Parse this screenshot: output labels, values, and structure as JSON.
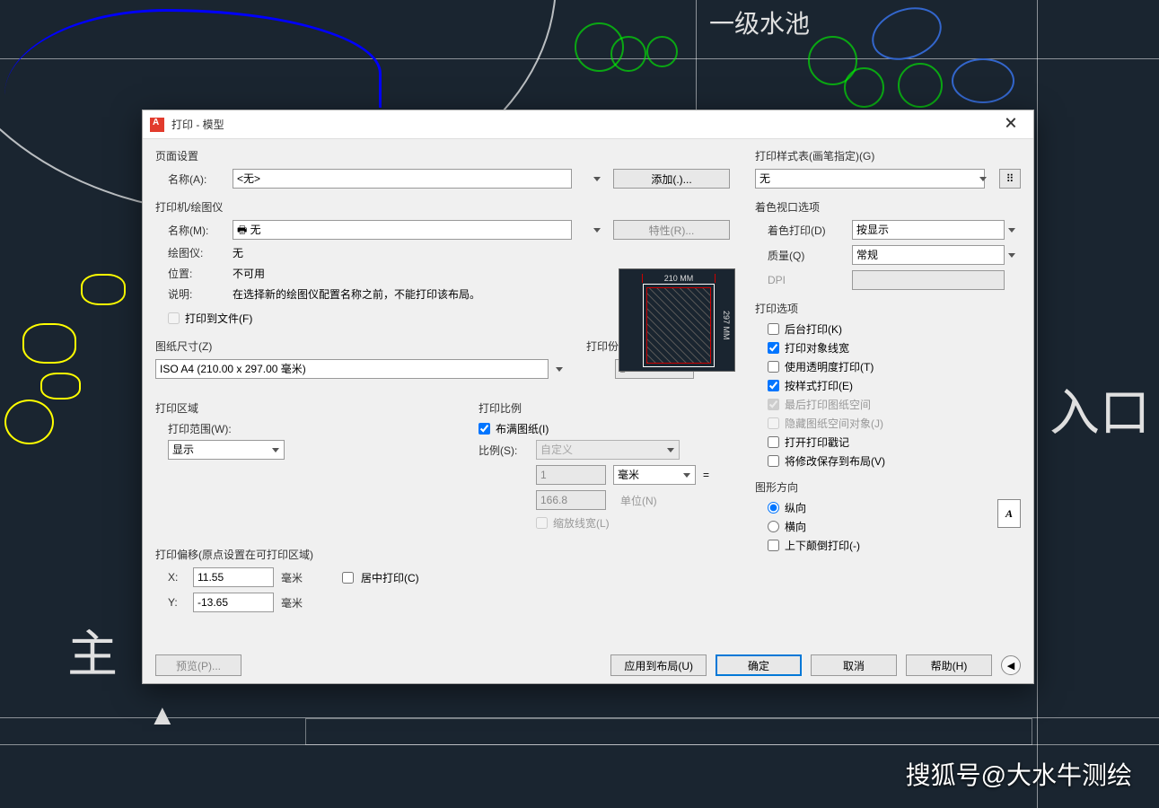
{
  "bg": {
    "pool": "一级水池",
    "entry": "入口",
    "main": "主",
    "watermark": "搜狐号@大水牛测绘"
  },
  "title": "打印 - 模型",
  "pageSetup": {
    "heading": "页面设置",
    "nameLabel": "名称(A):",
    "nameValue": "<无>",
    "addBtn": "添加(.)..."
  },
  "printer": {
    "heading": "打印机/绘图仪",
    "nameLabel": "名称(M):",
    "nameValue": "无",
    "propertiesBtn": "特性(R)...",
    "plotterLabel": "绘图仪:",
    "plotterValue": "无",
    "locationLabel": "位置:",
    "locationValue": "不可用",
    "descLabel": "说明:",
    "descValue": "在选择新的绘图仪配置名称之前，不能打印该布局。",
    "toFile": "打印到文件(F)",
    "pw": "210 MM",
    "ph": "297 MM"
  },
  "paperSize": {
    "heading": "图纸尺寸(Z)",
    "value": "ISO A4 (210.00 x 297.00 毫米)"
  },
  "copies": {
    "heading": "打印份数(B)",
    "value": "1"
  },
  "plotArea": {
    "heading": "打印区域",
    "rangeLabel": "打印范围(W):",
    "rangeValue": "显示"
  },
  "plotScale": {
    "heading": "打印比例",
    "fit": "布满图纸(I)",
    "scaleLabel": "比例(S):",
    "scaleValue": "自定义",
    "unitInput": "1",
    "unitSel": "毫米",
    "eq": "=",
    "drawInput": "166.8",
    "drawUnitLabel": "单位(N)",
    "lineweights": "缩放线宽(L)"
  },
  "plotOffset": {
    "heading": "打印偏移(原点设置在可打印区域)",
    "xLabel": "X:",
    "xValue": "11.55",
    "xUnit": "毫米",
    "yLabel": "Y:",
    "yValue": "-13.65",
    "yUnit": "毫米",
    "center": "居中打印(C)"
  },
  "styleTable": {
    "heading": "打印样式表(画笔指定)(G)",
    "value": "无"
  },
  "shaded": {
    "heading": "着色视口选项",
    "shadeLabel": "着色打印(D)",
    "shadeValue": "按显示",
    "qualityLabel": "质量(Q)",
    "qualityValue": "常规",
    "dpiLabel": "DPI"
  },
  "options": {
    "heading": "打印选项",
    "bg": "后台打印(K)",
    "lw": "打印对象线宽",
    "trans": "使用透明度打印(T)",
    "styles": "按样式打印(E)",
    "last": "最后打印图纸空间",
    "hide": "隐藏图纸空间对象(J)",
    "stamp": "打开打印戳记",
    "save": "将修改保存到布局(V)"
  },
  "orient": {
    "heading": "图形方向",
    "portrait": "纵向",
    "landscape": "横向",
    "upside": "上下颠倒打印(-)"
  },
  "footer": {
    "preview": "预览(P)...",
    "apply": "应用到布局(U)",
    "ok": "确定",
    "cancel": "取消",
    "help": "帮助(H)"
  }
}
